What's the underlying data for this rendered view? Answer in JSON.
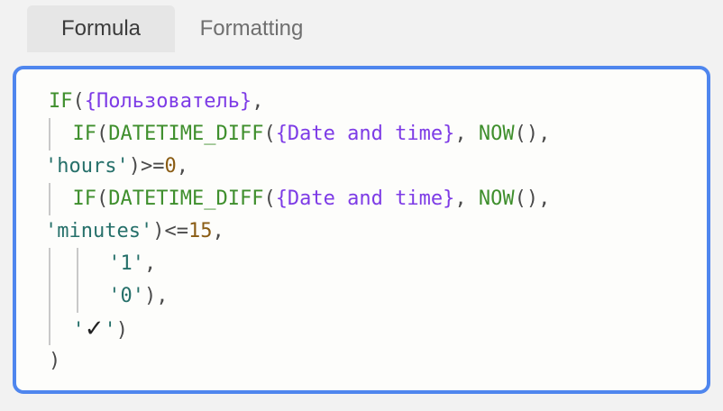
{
  "tabs": [
    {
      "label": "Formula",
      "active": true
    },
    {
      "label": "Formatting",
      "active": false
    }
  ],
  "colors": {
    "function": "#3f8f2d",
    "field": "#7d3be6",
    "string": "#26706a",
    "number": "#8a5c14",
    "border": "#4f86ee"
  },
  "formula": {
    "l1": {
      "fn": "IF",
      "open": "(",
      "field": "{Пользователь}",
      "comma": ","
    },
    "l2": {
      "fn": "IF",
      "open": "(",
      "fn2": "DATETIME_DIFF",
      "open2": "(",
      "field": "{Date and time}",
      "sep": ", ",
      "fn3": "NOW",
      "parens": "()",
      "comma": ","
    },
    "l3": {
      "str": "'hours'",
      "close": ")",
      "op": ">=",
      "num": "0",
      "comma": ","
    },
    "l4": {
      "fn": "IF",
      "open": "(",
      "fn2": "DATETIME_DIFF",
      "open2": "(",
      "field": "{Date and time}",
      "sep": ", ",
      "fn3": "NOW",
      "parens": "()",
      "comma": ","
    },
    "l5": {
      "str": "'minutes'",
      "close": ")",
      "op": "<=",
      "num": "15",
      "comma": ","
    },
    "l6": {
      "str": "'1'",
      "comma": ","
    },
    "l7": {
      "str": "'0'",
      "close": ")",
      "comma": ","
    },
    "l8": {
      "q1": "'",
      "check": "✓",
      "q2": "'",
      "close": ")"
    },
    "l9": {
      "close": ")"
    }
  }
}
